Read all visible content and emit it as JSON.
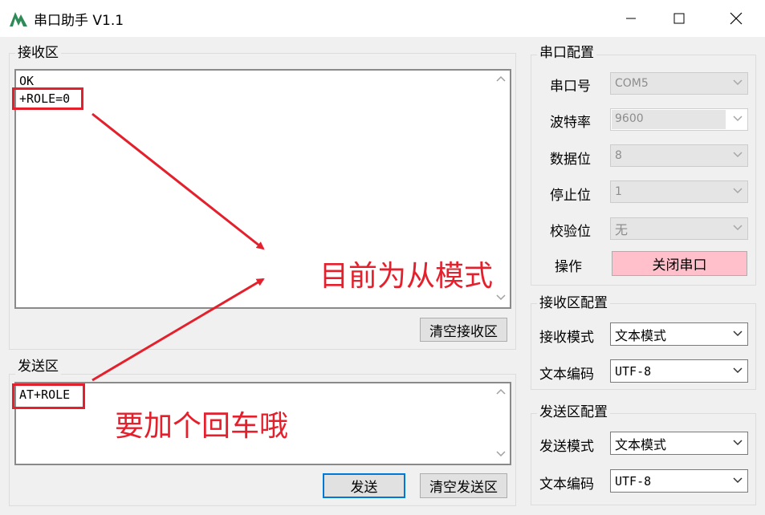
{
  "window": {
    "title": "串口助手 V1.1",
    "controls": [
      "minimize",
      "maximize",
      "close"
    ],
    "icon": "app-logo-icon"
  },
  "receive": {
    "group_label": "接收区",
    "lines": [
      "OK",
      "+ROLE=0"
    ],
    "clear_button": "清空接收区"
  },
  "send": {
    "group_label": "发送区",
    "text": "AT+ROLE",
    "send_button": "发送",
    "clear_button": "清空发送区"
  },
  "serial_config": {
    "group_label": "串口配置",
    "port": {
      "label": "串口号",
      "value": "COM5"
    },
    "baud": {
      "label": "波特率",
      "value": "9600"
    },
    "data_bits": {
      "label": "数据位",
      "value": "8"
    },
    "stop_bits": {
      "label": "停止位",
      "value": "1"
    },
    "parity": {
      "label": "校验位",
      "value": "无"
    },
    "operation": {
      "label": "操作",
      "button": "关闭串口",
      "button_color": "#ffc0cb"
    }
  },
  "receive_config": {
    "group_label": "接收区配置",
    "mode": {
      "label": "接收模式",
      "value": "文本模式"
    },
    "encoding": {
      "label": "文本编码",
      "value": "UTF-8"
    }
  },
  "send_config": {
    "group_label": "发送区配置",
    "mode": {
      "label": "发送模式",
      "value": "文本模式"
    },
    "encoding": {
      "label": "文本编码",
      "value": "UTF-8"
    }
  },
  "annotations": {
    "receive_note": "目前为从模式",
    "send_note": "要加个回车哦",
    "color": "#e4202c"
  },
  "colors": {
    "accent": "#0078d7",
    "window_bg": "#f0f0f0"
  }
}
